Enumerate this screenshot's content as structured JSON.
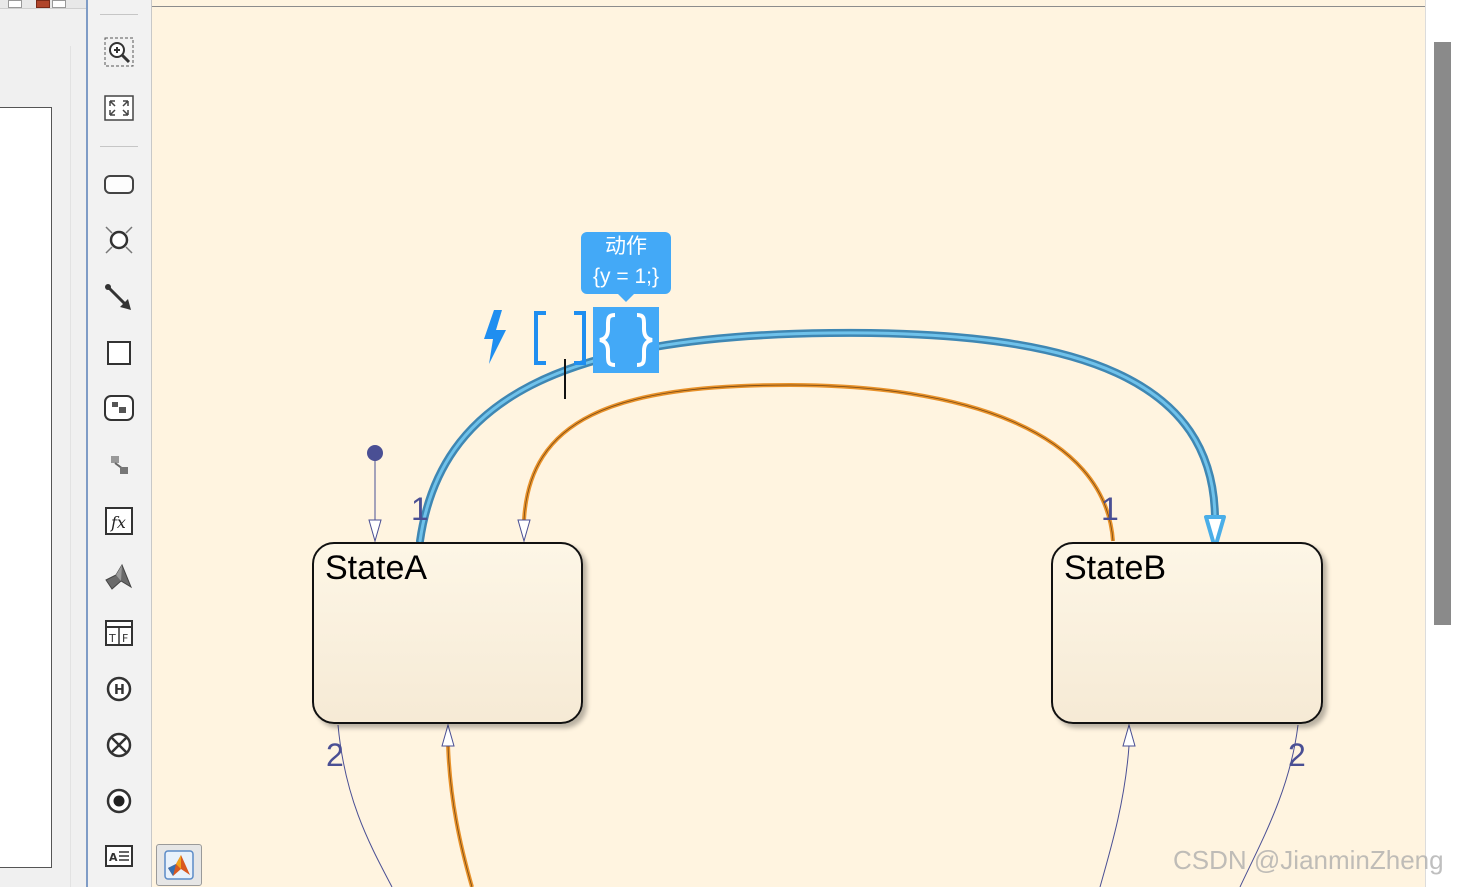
{
  "palette": {
    "tools": [
      {
        "name": "zoom-in-icon"
      },
      {
        "name": "fit-view-icon"
      },
      {
        "name": "state-tool-icon"
      },
      {
        "name": "junction-tool-icon"
      },
      {
        "name": "default-transition-tool-icon"
      },
      {
        "name": "box-tool-icon"
      },
      {
        "name": "simulink-function-tool-icon"
      },
      {
        "name": "graphical-function-tool-icon"
      },
      {
        "name": "matlab-function-tool-icon"
      },
      {
        "name": "matlab-logo-tool-icon"
      },
      {
        "name": "truth-table-tool-icon"
      },
      {
        "name": "history-junction-tool-icon"
      },
      {
        "name": "exit-junction-tool-icon"
      },
      {
        "name": "entry-junction-tool-icon"
      },
      {
        "name": "annotation-tool-icon"
      }
    ]
  },
  "chart": {
    "states": [
      {
        "name": "StateA"
      },
      {
        "name": "StateB"
      }
    ],
    "transition_labels": {
      "a_to_b_priority": "1",
      "b_to_a_priority": "1",
      "a_bottom_priority": "2",
      "b_bottom_priority": "2"
    },
    "tooltip": {
      "title": "动作",
      "value": "{y = 1;}"
    },
    "label_helpers": {
      "event_icon": "lightning-icon",
      "condition_icon": "square-brackets-icon",
      "action_icon": "curly-braces-icon"
    },
    "colors": {
      "canvas": "#fff4e0",
      "selected_transition": "#5ab0dd",
      "highlight_transition": "#e8922b",
      "transition_label": "#4a4f94",
      "tooltip": "#43a9f7"
    }
  },
  "watermark": "CSDN @JianminZheng"
}
